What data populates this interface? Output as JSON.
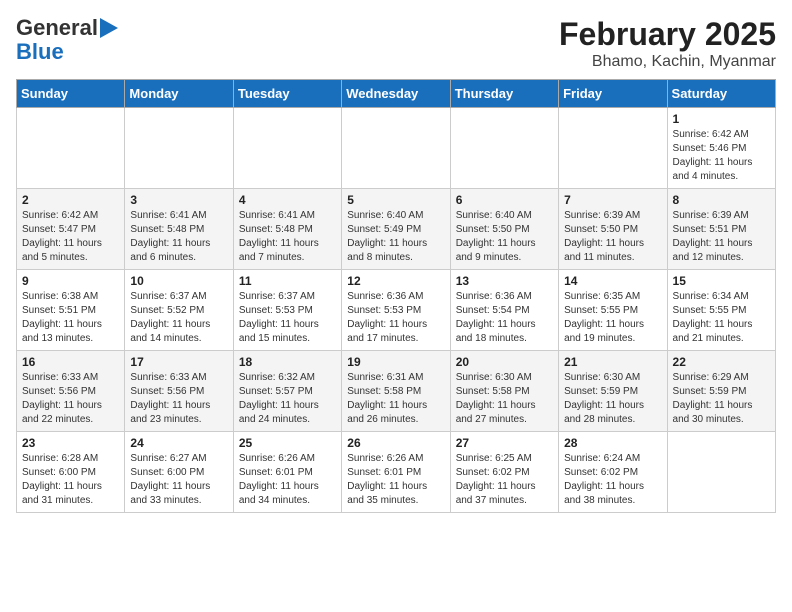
{
  "logo": {
    "line1": "General",
    "line2": "Blue"
  },
  "header": {
    "title": "February 2025",
    "subtitle": "Bhamo, Kachin, Myanmar"
  },
  "days_of_week": [
    "Sunday",
    "Monday",
    "Tuesday",
    "Wednesday",
    "Thursday",
    "Friday",
    "Saturday"
  ],
  "weeks": [
    [
      {
        "day": "",
        "info": ""
      },
      {
        "day": "",
        "info": ""
      },
      {
        "day": "",
        "info": ""
      },
      {
        "day": "",
        "info": ""
      },
      {
        "day": "",
        "info": ""
      },
      {
        "day": "",
        "info": ""
      },
      {
        "day": "1",
        "info": "Sunrise: 6:42 AM\nSunset: 5:46 PM\nDaylight: 11 hours and 4 minutes."
      }
    ],
    [
      {
        "day": "2",
        "info": "Sunrise: 6:42 AM\nSunset: 5:47 PM\nDaylight: 11 hours and 5 minutes."
      },
      {
        "day": "3",
        "info": "Sunrise: 6:41 AM\nSunset: 5:48 PM\nDaylight: 11 hours and 6 minutes."
      },
      {
        "day": "4",
        "info": "Sunrise: 6:41 AM\nSunset: 5:48 PM\nDaylight: 11 hours and 7 minutes."
      },
      {
        "day": "5",
        "info": "Sunrise: 6:40 AM\nSunset: 5:49 PM\nDaylight: 11 hours and 8 minutes."
      },
      {
        "day": "6",
        "info": "Sunrise: 6:40 AM\nSunset: 5:50 PM\nDaylight: 11 hours and 9 minutes."
      },
      {
        "day": "7",
        "info": "Sunrise: 6:39 AM\nSunset: 5:50 PM\nDaylight: 11 hours and 11 minutes."
      },
      {
        "day": "8",
        "info": "Sunrise: 6:39 AM\nSunset: 5:51 PM\nDaylight: 11 hours and 12 minutes."
      }
    ],
    [
      {
        "day": "9",
        "info": "Sunrise: 6:38 AM\nSunset: 5:51 PM\nDaylight: 11 hours and 13 minutes."
      },
      {
        "day": "10",
        "info": "Sunrise: 6:37 AM\nSunset: 5:52 PM\nDaylight: 11 hours and 14 minutes."
      },
      {
        "day": "11",
        "info": "Sunrise: 6:37 AM\nSunset: 5:53 PM\nDaylight: 11 hours and 15 minutes."
      },
      {
        "day": "12",
        "info": "Sunrise: 6:36 AM\nSunset: 5:53 PM\nDaylight: 11 hours and 17 minutes."
      },
      {
        "day": "13",
        "info": "Sunrise: 6:36 AM\nSunset: 5:54 PM\nDaylight: 11 hours and 18 minutes."
      },
      {
        "day": "14",
        "info": "Sunrise: 6:35 AM\nSunset: 5:55 PM\nDaylight: 11 hours and 19 minutes."
      },
      {
        "day": "15",
        "info": "Sunrise: 6:34 AM\nSunset: 5:55 PM\nDaylight: 11 hours and 21 minutes."
      }
    ],
    [
      {
        "day": "16",
        "info": "Sunrise: 6:33 AM\nSunset: 5:56 PM\nDaylight: 11 hours and 22 minutes."
      },
      {
        "day": "17",
        "info": "Sunrise: 6:33 AM\nSunset: 5:56 PM\nDaylight: 11 hours and 23 minutes."
      },
      {
        "day": "18",
        "info": "Sunrise: 6:32 AM\nSunset: 5:57 PM\nDaylight: 11 hours and 24 minutes."
      },
      {
        "day": "19",
        "info": "Sunrise: 6:31 AM\nSunset: 5:58 PM\nDaylight: 11 hours and 26 minutes."
      },
      {
        "day": "20",
        "info": "Sunrise: 6:30 AM\nSunset: 5:58 PM\nDaylight: 11 hours and 27 minutes."
      },
      {
        "day": "21",
        "info": "Sunrise: 6:30 AM\nSunset: 5:59 PM\nDaylight: 11 hours and 28 minutes."
      },
      {
        "day": "22",
        "info": "Sunrise: 6:29 AM\nSunset: 5:59 PM\nDaylight: 11 hours and 30 minutes."
      }
    ],
    [
      {
        "day": "23",
        "info": "Sunrise: 6:28 AM\nSunset: 6:00 PM\nDaylight: 11 hours and 31 minutes."
      },
      {
        "day": "24",
        "info": "Sunrise: 6:27 AM\nSunset: 6:00 PM\nDaylight: 11 hours and 33 minutes."
      },
      {
        "day": "25",
        "info": "Sunrise: 6:26 AM\nSunset: 6:01 PM\nDaylight: 11 hours and 34 minutes."
      },
      {
        "day": "26",
        "info": "Sunrise: 6:26 AM\nSunset: 6:01 PM\nDaylight: 11 hours and 35 minutes."
      },
      {
        "day": "27",
        "info": "Sunrise: 6:25 AM\nSunset: 6:02 PM\nDaylight: 11 hours and 37 minutes."
      },
      {
        "day": "28",
        "info": "Sunrise: 6:24 AM\nSunset: 6:02 PM\nDaylight: 11 hours and 38 minutes."
      },
      {
        "day": "",
        "info": ""
      }
    ]
  ]
}
